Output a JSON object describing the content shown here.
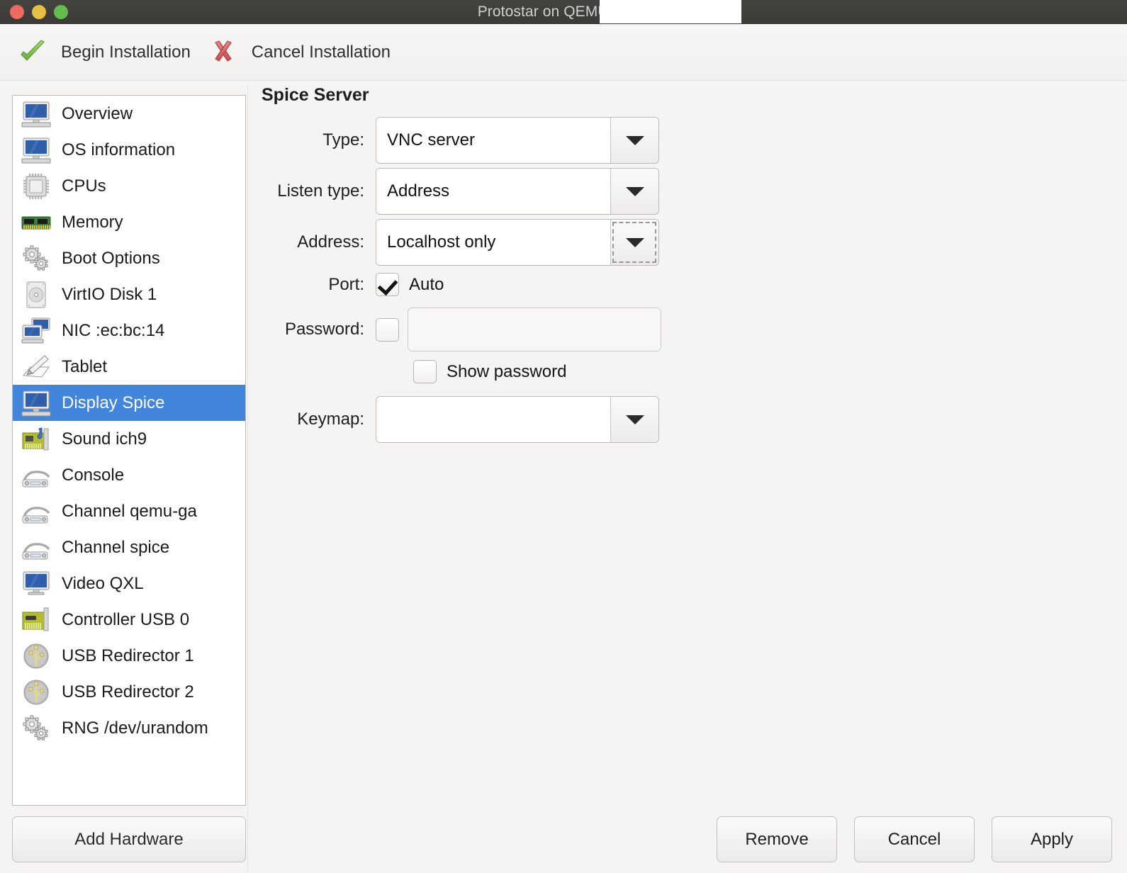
{
  "window": {
    "title": "Protostar on QEMU/KVM: ",
    "controls": [
      "close",
      "minimize",
      "maximize"
    ]
  },
  "toolbar": {
    "begin_label": "Begin Installation",
    "cancel_label": "Cancel Installation"
  },
  "sidebar": {
    "items": [
      {
        "label": "Overview",
        "icon": "monitor-icon",
        "selected": false
      },
      {
        "label": "OS information",
        "icon": "monitor-icon",
        "selected": false
      },
      {
        "label": "CPUs",
        "icon": "cpu-chip-icon",
        "selected": false
      },
      {
        "label": "Memory",
        "icon": "memory-stick-icon",
        "selected": false
      },
      {
        "label": "Boot Options",
        "icon": "gears-icon",
        "selected": false
      },
      {
        "label": "VirtIO Disk 1",
        "icon": "harddisk-icon",
        "selected": false
      },
      {
        "label": "NIC :ec:bc:14",
        "icon": "network-icon",
        "selected": false
      },
      {
        "label": "Tablet",
        "icon": "tablet-pen-icon",
        "selected": false
      },
      {
        "label": "Display Spice",
        "icon": "monitor-icon",
        "selected": true
      },
      {
        "label": "Sound ich9",
        "icon": "sound-card-icon",
        "selected": false
      },
      {
        "label": "Console",
        "icon": "console-icon",
        "selected": false
      },
      {
        "label": "Channel qemu-ga",
        "icon": "console-icon",
        "selected": false
      },
      {
        "label": "Channel spice",
        "icon": "console-icon",
        "selected": false
      },
      {
        "label": "Video QXL",
        "icon": "display-icon",
        "selected": false
      },
      {
        "label": "Controller USB 0",
        "icon": "pci-card-icon",
        "selected": false
      },
      {
        "label": "USB Redirector 1",
        "icon": "usb-icon",
        "selected": false
      },
      {
        "label": "USB Redirector 2",
        "icon": "usb-icon",
        "selected": false
      },
      {
        "label": "RNG /dev/urandom",
        "icon": "gears-icon",
        "selected": false
      }
    ],
    "add_hardware_label": "Add Hardware"
  },
  "main": {
    "section_title": "Spice Server",
    "fields": {
      "type_label": "Type:",
      "type_value": "VNC server",
      "listen_type_label": "Listen type:",
      "listen_type_value": "Address",
      "address_label": "Address:",
      "address_value": "Localhost only",
      "port_label": "Port:",
      "port_auto_label": "Auto",
      "port_auto_checked": true,
      "password_label": "Password:",
      "password_enabled": false,
      "password_value": "",
      "show_password_label": "Show password",
      "show_password_checked": false,
      "keymap_label": "Keymap:",
      "keymap_value": ""
    }
  },
  "footer": {
    "remove_label": "Remove",
    "cancel_label": "Cancel",
    "apply_label": "Apply"
  },
  "colors": {
    "selection_blue": "#4285dd",
    "window_bg": "#f5f4f2",
    "titlebar_bg": "#3f3d3a",
    "close_red": "#ed6a5e",
    "minimize_yellow": "#e5c044",
    "maximize_green": "#62bd4d"
  }
}
